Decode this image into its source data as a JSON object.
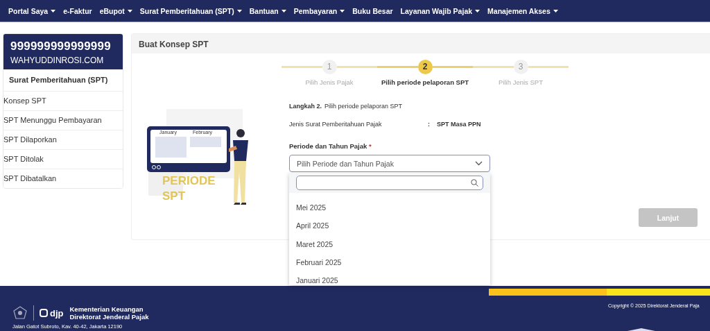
{
  "nav": [
    {
      "label": "Portal Saya",
      "dropdown": true
    },
    {
      "label": "e-Faktur",
      "dropdown": false
    },
    {
      "label": "eBupot",
      "dropdown": true
    },
    {
      "label": "Surat Pemberitahuan (SPT)",
      "dropdown": true
    },
    {
      "label": "Bantuan",
      "dropdown": true
    },
    {
      "label": "Pembayaran",
      "dropdown": true
    },
    {
      "label": "Buku Besar",
      "dropdown": false
    },
    {
      "label": "Layanan Wajib Pajak",
      "dropdown": true
    },
    {
      "label": "Manajemen Akses",
      "dropdown": true
    }
  ],
  "sidebar": {
    "account_id": "999999999999999",
    "account_name": "WAHYUDDINROSI.COM",
    "section": "Surat Pemberitahuan (SPT)",
    "items": [
      {
        "label": "Konsep SPT",
        "selected": false
      },
      {
        "label": "SPT Menunggu Pembayaran",
        "selected": false
      },
      {
        "label": "SPT Dilaporkan",
        "selected": false
      },
      {
        "label": "SPT Ditolak",
        "selected": false
      },
      {
        "label": "SPT Dibatalkan",
        "selected": false
      }
    ]
  },
  "main": {
    "title": "Buat Konsep SPT",
    "steps": [
      {
        "number": "1",
        "label": "Pilih Jenis Pajak",
        "selected": false
      },
      {
        "number": "2",
        "label": "Pilih periode pelaporan SPT",
        "selected": true
      },
      {
        "number": "3",
        "label": "Pilih Jenis SPT",
        "selected": false
      }
    ],
    "illustration": {
      "months": [
        "January",
        "February"
      ],
      "caption_lines": [
        "PERIODE",
        "SPT"
      ]
    },
    "step_label": "Langkah 2.",
    "step_text": "Pilih periode pelaporan SPT",
    "info_label": "Jenis Surat Pemberitahuan Pajak",
    "info_separator": ":",
    "info_value": "SPT Masa PPN",
    "field_label": "Periode dan Tahun Pajak",
    "required_mark": "*",
    "select": {
      "placeholder": "Pilih Periode dan Tahun Pajak",
      "expanded": true,
      "options": [
        "Mei 2025",
        "April 2025",
        "Maret 2025",
        "Februari 2025",
        "Januari 2025"
      ]
    },
    "next_button": {
      "label": "Lanjut",
      "disabled": true
    }
  },
  "footer": {
    "brand": "djp",
    "org_lines": [
      "Kementerian Keuangan",
      "Direktorat Jenderal Pajak"
    ],
    "address": "Jalan Gatot Subroto, Kav. 40-42, Jakarta 12190",
    "copyright": "Copyright © 2025 Direktorat Jenderal Paja"
  }
}
